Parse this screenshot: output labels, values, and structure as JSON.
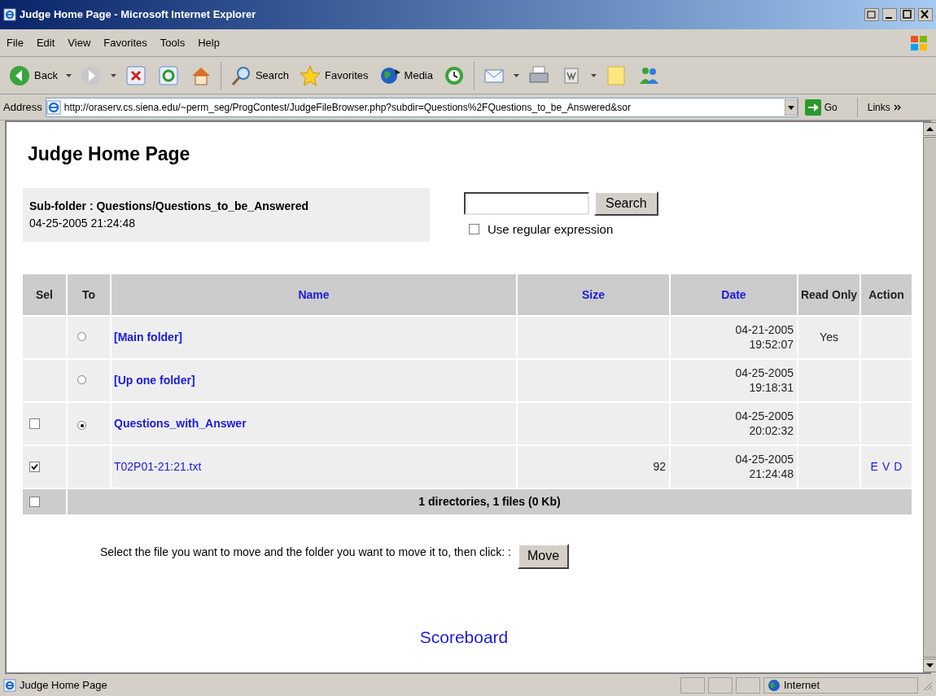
{
  "window": {
    "title": "Judge Home Page - Microsoft Internet Explorer"
  },
  "menu": [
    "File",
    "Edit",
    "View",
    "Favorites",
    "Tools",
    "Help"
  ],
  "toolbar": [
    {
      "kind": "back",
      "label": "Back"
    },
    {
      "kind": "forward"
    },
    {
      "kind": "stop"
    },
    {
      "kind": "refresh"
    },
    {
      "kind": "home"
    },
    {
      "kind": "search",
      "label": "Search"
    },
    {
      "kind": "favorites",
      "label": "Favorites"
    },
    {
      "kind": "media",
      "label": "Media"
    },
    {
      "kind": "history"
    },
    {
      "kind": "mail"
    },
    {
      "kind": "print"
    },
    {
      "kind": "edit"
    },
    {
      "kind": "note"
    },
    {
      "kind": "messenger"
    }
  ],
  "address_bar": {
    "label": "Address",
    "url": "http://oraserv.cs.siena.edu/~perm_seg/ProgContest/JudgeFileBrowser.php?subdir=Questions%2FQuestions_to_be_Answered&sor",
    "go": "Go",
    "links": "Links"
  },
  "page": {
    "heading": "Judge Home Page",
    "subfolder": {
      "label": "Sub-folder : Questions/Questions_to_be_Answered",
      "timestamp": "04-25-2005 21:24:48"
    },
    "search": {
      "button": "Search",
      "regex_label": "Use regular expression",
      "regex_checked": false
    },
    "table": {
      "columns": [
        {
          "label": "Sel",
          "link": false
        },
        {
          "label": "To",
          "link": false
        },
        {
          "label": "Name",
          "link": true
        },
        {
          "label": "Size",
          "link": true
        },
        {
          "label": "Date",
          "link": true
        },
        {
          "label": "Read Only",
          "link": false
        },
        {
          "label": "Action",
          "link": false
        }
      ],
      "rows": [
        {
          "sel": null,
          "to": {
            "selected": false
          },
          "name": "[Main folder]",
          "folder": true,
          "size": "",
          "date": "04-21-2005",
          "time": "19:52:07",
          "read_only": "Yes",
          "actions": []
        },
        {
          "sel": null,
          "to": {
            "selected": false
          },
          "name": "[Up one folder]",
          "folder": true,
          "size": "",
          "date": "04-25-2005",
          "time": "19:18:31",
          "read_only": "",
          "actions": []
        },
        {
          "sel": {
            "checked": false
          },
          "to": {
            "selected": true
          },
          "name": "Questions_with_Answer",
          "folder": true,
          "size": "",
          "date": "04-25-2005",
          "time": "20:02:32",
          "read_only": "",
          "actions": []
        },
        {
          "sel": {
            "checked": true
          },
          "to": null,
          "name": "T02P01-21:21.txt",
          "folder": false,
          "size": "92",
          "date": "04-25-2005",
          "time": "21:24:48",
          "read_only": "",
          "actions": [
            "E",
            "V",
            "D"
          ]
        }
      ],
      "footer": {
        "checked": false,
        "summary": "1 directories, 1 files (0 Kb)"
      }
    },
    "move_text": "Select the file you want to move and the folder you want to move it to, then click: :",
    "move_button": "Move",
    "scoreboard": "Scoreboard"
  },
  "status_bar": {
    "text": "Judge Home Page",
    "zone": "Internet"
  }
}
